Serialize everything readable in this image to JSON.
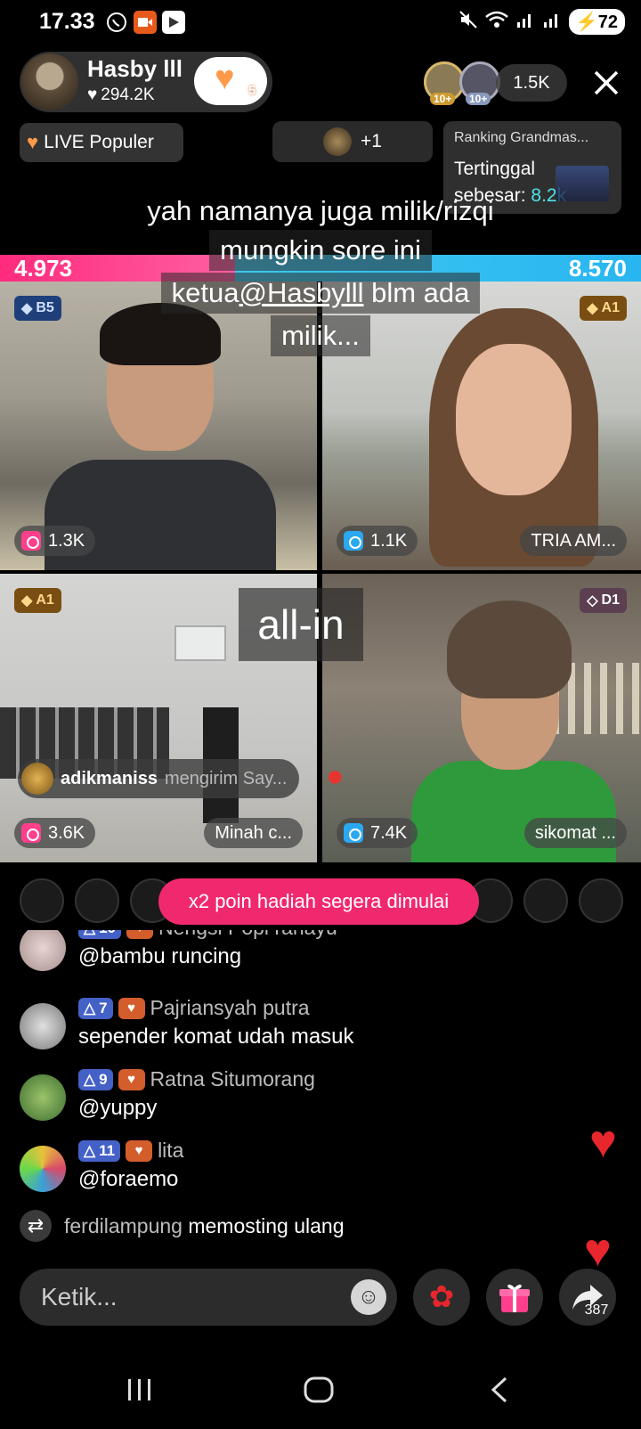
{
  "status_bar": {
    "time": "17.33",
    "battery": "72",
    "app_icons": [
      "whatsapp-icon",
      "video-record-icon",
      "play-store-icon"
    ],
    "system_icons": [
      "mute-icon",
      "wifi-icon",
      "signal-icon",
      "signal-icon"
    ]
  },
  "host": {
    "name": "Hasby lll",
    "likes": "294.2K",
    "like_button_count": "5"
  },
  "viewers": {
    "badge1": "10+",
    "badge2": "10+",
    "count": "1.5K"
  },
  "live_popular": "LIVE Populer",
  "plus_one": "+1",
  "ranking": {
    "title": "Ranking Grandmas...",
    "line1": "Tertinggal",
    "line2_prefix": "sebesar: ",
    "line2_value": "8.2k"
  },
  "overlay_comment": {
    "line1": "yah namanya juga milik/rizqi",
    "line2": "mungkin sore ini",
    "line3_prefix": "ketua",
    "line3_mention": "@Hasbylll",
    "line3_suffix": " blm ada",
    "line4": "milik..."
  },
  "scores": {
    "left": "4.973",
    "right": "8.570",
    "left_share": 0.367
  },
  "tiles": [
    {
      "rank": "B5",
      "count": "1.3K",
      "name": ""
    },
    {
      "rank": "A1",
      "count": "1.1K",
      "name": "TRIA AM..."
    },
    {
      "rank": "A1",
      "count": "3.6K",
      "name": "Minah c..."
    },
    {
      "rank": "D1",
      "count": "7.4K",
      "name": "sikomat ..."
    }
  ],
  "allin": "all-in",
  "gift_notice": {
    "user": "adikmaniss",
    "text": "mengirim Say..."
  },
  "banner": "x2 poin hadiah segera dimulai",
  "chat": [
    {
      "level": "10",
      "user": "Nengsi Popi rahayu",
      "text": "@bambu runcing"
    },
    {
      "level": "7",
      "user": "Pajriansyah putra",
      "text": "sepender komat udah masuk"
    },
    {
      "level": "9",
      "user": "Ratna Situmorang",
      "text": "@yuppy"
    },
    {
      "level": "11",
      "user": "lita",
      "text": "@foraemo"
    }
  ],
  "repost": {
    "user": "ferdilampung",
    "text": "memosting ulang"
  },
  "input": {
    "placeholder": "Ketik..."
  },
  "share_count": "387",
  "colors": {
    "pink": "#f0296f",
    "blue_score": "#29b6f0",
    "level_badge": "#4461c8",
    "heart": "#e8262e"
  }
}
